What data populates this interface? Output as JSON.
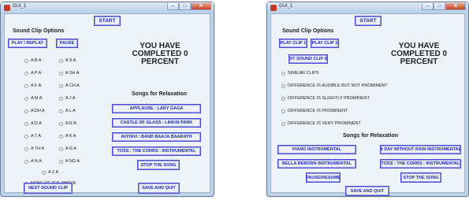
{
  "left_window": {
    "title": "GUI_1",
    "start_label": "START",
    "section_label": "Sound Clip Options",
    "play_label": "PLAY / REPLAY",
    "pause_label": "PAUSE",
    "status_lines": [
      "YOU HAVE",
      "COMPLETED 0",
      "PERCENT"
    ],
    "options_col1": [
      "A B A",
      "A P A",
      "A F A",
      "A M A",
      "A DH A",
      "A D A",
      "A T A",
      "A TH A",
      "A N A"
    ],
    "options_col2": [
      "A S A",
      "A SH A",
      "A CH A",
      "A J A",
      "A L A",
      "A R A",
      "A K A",
      "A G A",
      "A NG A"
    ],
    "option_center": "A Z A",
    "option_none": "NONE OF THE ABOVE",
    "songs_label": "Songs for Relaxation",
    "songs": [
      "APPLAUSE : LADY GAGA",
      "CASTLE OF GLASS : LINKIN PARK",
      "AVIYAVI : BAND BAAJA BAARATH",
      "TOSS : THE CORRS : INSTRUMENTAL"
    ],
    "stop_label": "STOP THE SONG",
    "next_label": "NEXT SOUND CLIP",
    "save_label": "SAVE AND QUIT"
  },
  "right_window": {
    "title": "GUI_1",
    "start_label": "START",
    "section_label": "Sound Clip Options",
    "play1_label": "PLAY CLIP 1",
    "play2_label": "PLAY CLIP 2",
    "next_set_label": "NEXT SOUND CLIP SET",
    "status_lines": [
      "YOU HAVE",
      "COMPLETED 0",
      "PERCENT"
    ],
    "options": [
      "SIMILAR CLIPS",
      "DIFFERENCE IS AUDIBLE BUT NOT PROMINENT",
      "DIFFERENCE IS SLIGHTLY PROMINENT",
      "DIFFERENCE IS PROMINENT",
      "DIFFERENCE IS VERY PROMINENT"
    ],
    "songs_label": "Songs for Relaxation",
    "songs": [
      "PIANO INSTRUMENTAL",
      "A DAY WITHOUT RAIN INSTRUMENTAL",
      "BELLA REBORN INSTRUMENTAL",
      "TOSS : THE CORRS : INSTRUMENTAL"
    ],
    "pause_resume_label": "PAUSE/RESUME",
    "stop_label": "STOP THE SONG",
    "save_label": "SAVE AND QUIT"
  },
  "window_controls": {
    "minimize": "–",
    "maximize": "□",
    "close": "✕"
  },
  "colors": {
    "button_text": "#1c2bb3",
    "button_border": "#4a4ad0",
    "close": "#c8442b"
  }
}
